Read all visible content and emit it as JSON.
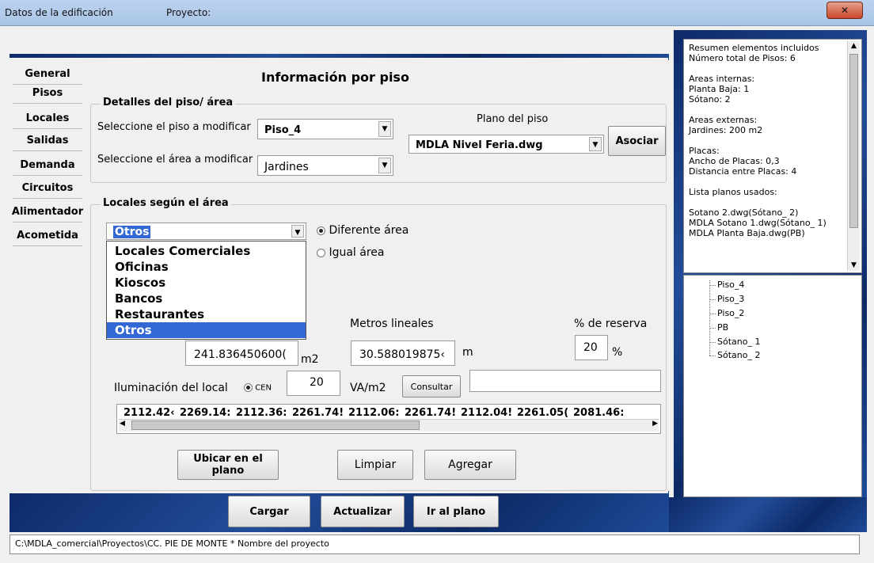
{
  "window": {
    "title": "Datos de la edificación",
    "project_label": "Proyecto:",
    "close_icon": "close-icon"
  },
  "nav": {
    "items": [
      "General",
      "Pisos",
      "Locales",
      "Salidas",
      "Demanda",
      "Circuitos",
      "Alimentador",
      "Acometida"
    ]
  },
  "main": {
    "heading": "Información por piso",
    "floor_details": {
      "legend": "Detalles del piso/ área",
      "select_floor_label": "Seleccione el piso a modificar",
      "floor_value": "Piso_4",
      "select_area_label": "Seleccione el área a modificar",
      "area_value": "Jardines",
      "plan_label": "Plano del piso",
      "plan_value": "MDLA Nivel Feria.dwg",
      "associate_button": "Asociar"
    },
    "locales": {
      "legend": "Locales según el área",
      "type_value": "Otros",
      "dropdown_options": [
        "Locales Comerciales",
        "Oficinas",
        "Kioscos",
        "Bancos",
        "Restaurantes",
        "Otros"
      ],
      "selected_option": "Otros",
      "radio_diferente": "Diferente área",
      "radio_igual": "Igual área",
      "metros_label": "Metros lineales",
      "reserva_label": "% de reserva",
      "area_value": "241.836450600(",
      "area_unit": "m2",
      "metros_value": "30.588019875‹",
      "metros_unit": "m",
      "reserva_value": "20",
      "reserva_unit": "%",
      "iluminacion_label": "Iluminación del local",
      "cen_label": "CEN",
      "iluminacion_value": "20",
      "iluminacion_unit": "VA/m2",
      "consultar_button": "Consultar",
      "consultar_field": "",
      "list_values": [
        "2112.42‹",
        "2269.14:",
        "2112.36:",
        "2261.74!",
        "2112.06:",
        "2261.74!",
        "2112.04!",
        "2261.05(",
        "2081.46:"
      ],
      "ubicar_button": "Ubicar en el plano",
      "limpiar_button": "Limpiar",
      "agregar_button": "Agregar"
    }
  },
  "bottom_buttons": {
    "cargar": "Cargar",
    "actualizar": "Actualizar",
    "ir_plano": "Ir al plano"
  },
  "summary": {
    "lines": [
      "Resumen elementos incluidos",
      "Número total de Pisos: 6",
      "",
      "Areas internas:",
      "Planta Baja: 1",
      "Sótano: 2",
      "",
      "Areas externas:",
      "Jardines: 200 m2",
      "",
      "Placas:",
      "Ancho de Placas: 0,3",
      "Distancia entre Placas: 4",
      "",
      "Lista planos usados:",
      "",
      "Sotano 2.dwg(Sótano_ 2)",
      "MDLA Sotano 1.dwg(Sótano_ 1)",
      "MDLA Planta Baja.dwg(PB)"
    ]
  },
  "tree": {
    "items": [
      "Piso_4",
      "Piso_3",
      "Piso_2",
      "PB",
      "Sótano_ 1",
      "Sótano_ 2"
    ]
  },
  "status": {
    "path": "C:\\MDLA_comercial\\Proyectos\\CC. PIE DE MONTE * Nombre del proyecto"
  }
}
